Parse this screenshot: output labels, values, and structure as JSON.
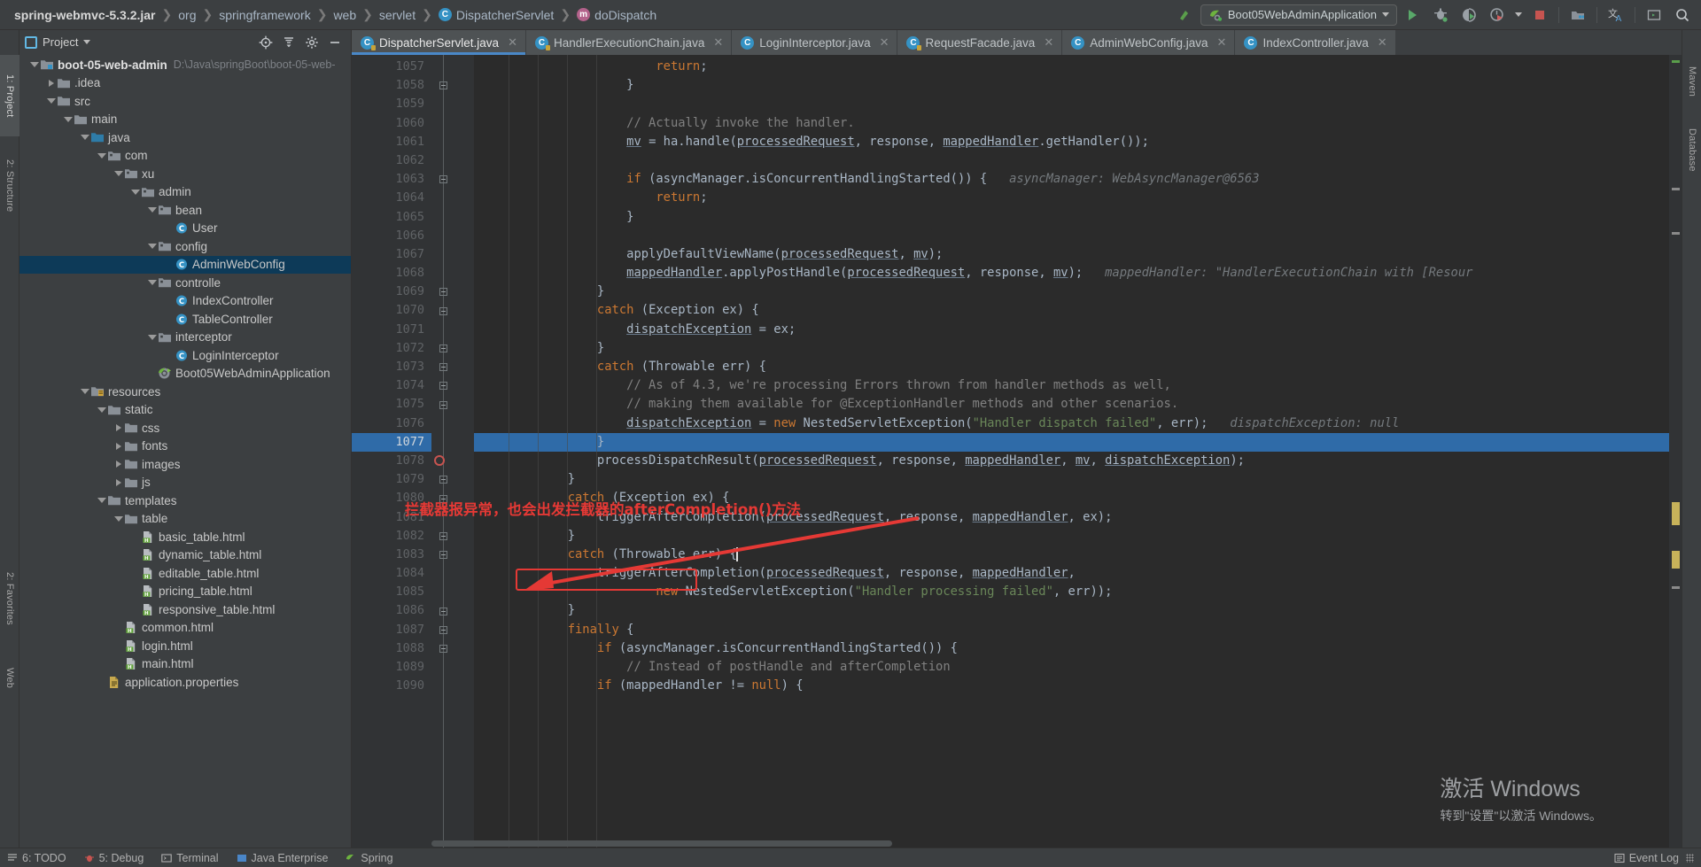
{
  "breadcrumb": {
    "items": [
      {
        "label": "spring-webmvc-5.3.2.jar",
        "icon": "jar-icon"
      },
      {
        "label": "org",
        "icon": "package-icon"
      },
      {
        "label": "springframework",
        "icon": "package-icon"
      },
      {
        "label": "web",
        "icon": "package-icon"
      },
      {
        "label": "servlet",
        "icon": "package-icon"
      },
      {
        "label": "DispatcherServlet",
        "icon": "class-icon"
      },
      {
        "label": "doDispatch",
        "icon": "method-icon"
      }
    ]
  },
  "toolbar": {
    "run_config": "Boot05WebAdminApplication",
    "buttons": [
      {
        "name": "run-button",
        "label": "Run"
      },
      {
        "name": "debug-button",
        "label": "Debug"
      },
      {
        "name": "run-with-coverage-button",
        "label": "Run with Coverage"
      },
      {
        "name": "profiler-button",
        "label": "Profiler"
      },
      {
        "name": "stop-button",
        "label": "Stop"
      },
      {
        "name": "project-structure-button",
        "label": "Project Structure"
      },
      {
        "name": "translate-button",
        "label": "Translate"
      },
      {
        "name": "terminal-button",
        "label": "Terminal"
      },
      {
        "name": "search-everywhere-button",
        "label": "Search Everywhere"
      }
    ]
  },
  "project_panel": {
    "title": "Project",
    "actions": [
      "locate-icon",
      "collapse-all-icon",
      "settings-icon",
      "hide-icon"
    ],
    "tree": [
      {
        "depth": 0,
        "twisty": "down",
        "icon": "module-folder",
        "label": "boot-05-web-admin",
        "bold": true,
        "path": "D:\\Java\\springBoot\\boot-05-web-",
        "selected": false
      },
      {
        "depth": 1,
        "twisty": "right",
        "icon": "folder",
        "label": ".idea",
        "selected": false
      },
      {
        "depth": 1,
        "twisty": "down",
        "icon": "folder",
        "label": "src",
        "selected": false
      },
      {
        "depth": 2,
        "twisty": "down",
        "icon": "folder",
        "label": "main",
        "selected": false
      },
      {
        "depth": 3,
        "twisty": "down",
        "icon": "source-folder",
        "label": "java",
        "selected": false
      },
      {
        "depth": 4,
        "twisty": "down",
        "icon": "package",
        "label": "com",
        "selected": false
      },
      {
        "depth": 5,
        "twisty": "down",
        "icon": "package",
        "label": "xu",
        "selected": false
      },
      {
        "depth": 6,
        "twisty": "down",
        "icon": "package",
        "label": "admin",
        "selected": false
      },
      {
        "depth": 7,
        "twisty": "down",
        "icon": "package",
        "label": "bean",
        "selected": false
      },
      {
        "depth": 8,
        "twisty": "none",
        "icon": "class",
        "label": "User",
        "selected": false
      },
      {
        "depth": 7,
        "twisty": "down",
        "icon": "package",
        "label": "config",
        "selected": false
      },
      {
        "depth": 8,
        "twisty": "none",
        "icon": "class",
        "label": "AdminWebConfig",
        "selected": true
      },
      {
        "depth": 7,
        "twisty": "down",
        "icon": "package",
        "label": "controlle",
        "selected": false
      },
      {
        "depth": 8,
        "twisty": "none",
        "icon": "class",
        "label": "IndexController",
        "selected": false
      },
      {
        "depth": 8,
        "twisty": "none",
        "icon": "class",
        "label": "TableController",
        "selected": false
      },
      {
        "depth": 7,
        "twisty": "down",
        "icon": "package",
        "label": "interceptor",
        "selected": false
      },
      {
        "depth": 8,
        "twisty": "none",
        "icon": "class",
        "label": "LoginInterceptor",
        "selected": false
      },
      {
        "depth": 7,
        "twisty": "none",
        "icon": "spring-class",
        "label": "Boot05WebAdminApplication",
        "selected": false
      },
      {
        "depth": 3,
        "twisty": "down",
        "icon": "resource-folder",
        "label": "resources",
        "selected": false
      },
      {
        "depth": 4,
        "twisty": "down",
        "icon": "folder",
        "label": "static",
        "selected": false
      },
      {
        "depth": 5,
        "twisty": "right",
        "icon": "folder",
        "label": "css",
        "selected": false
      },
      {
        "depth": 5,
        "twisty": "right",
        "icon": "folder",
        "label": "fonts",
        "selected": false
      },
      {
        "depth": 5,
        "twisty": "right",
        "icon": "folder",
        "label": "images",
        "selected": false
      },
      {
        "depth": 5,
        "twisty": "right",
        "icon": "folder",
        "label": "js",
        "selected": false
      },
      {
        "depth": 4,
        "twisty": "down",
        "icon": "folder",
        "label": "templates",
        "selected": false
      },
      {
        "depth": 5,
        "twisty": "down",
        "icon": "folder",
        "label": "table",
        "selected": false
      },
      {
        "depth": 6,
        "twisty": "none",
        "icon": "html",
        "label": "basic_table.html",
        "selected": false
      },
      {
        "depth": 6,
        "twisty": "none",
        "icon": "html",
        "label": "dynamic_table.html",
        "selected": false
      },
      {
        "depth": 6,
        "twisty": "none",
        "icon": "html",
        "label": "editable_table.html",
        "selected": false
      },
      {
        "depth": 6,
        "twisty": "none",
        "icon": "html",
        "label": "pricing_table.html",
        "selected": false
      },
      {
        "depth": 6,
        "twisty": "none",
        "icon": "html",
        "label": "responsive_table.html",
        "selected": false
      },
      {
        "depth": 5,
        "twisty": "none",
        "icon": "html",
        "label": "common.html",
        "selected": false
      },
      {
        "depth": 5,
        "twisty": "none",
        "icon": "html",
        "label": "login.html",
        "selected": false
      },
      {
        "depth": 5,
        "twisty": "none",
        "icon": "html",
        "label": "main.html",
        "selected": false
      },
      {
        "depth": 4,
        "twisty": "none",
        "icon": "properties",
        "label": "application.properties",
        "selected": false
      }
    ]
  },
  "editor_tabs": [
    {
      "label": "DispatcherServlet.java",
      "icon": "class-icon",
      "active": true,
      "readonly": true
    },
    {
      "label": "HandlerExecutionChain.java",
      "icon": "class-icon",
      "active": false,
      "readonly": true
    },
    {
      "label": "LoginInterceptor.java",
      "icon": "class-icon",
      "active": false,
      "readonly": false
    },
    {
      "label": "RequestFacade.java",
      "icon": "class-icon",
      "active": false,
      "readonly": true
    },
    {
      "label": "AdminWebConfig.java",
      "icon": "class-icon",
      "active": false,
      "readonly": false
    },
    {
      "label": "IndexController.java",
      "icon": "class-icon",
      "active": false,
      "readonly": false
    }
  ],
  "editor": {
    "first_line": 1057,
    "highlighted_line": 1077,
    "breakpoint_line": 1078,
    "caret_line": 1083,
    "lines": [
      {
        "n": 1057,
        "indent": 6,
        "tokens": [
          {
            "t": "return",
            "c": "kw"
          },
          {
            "t": ";",
            "c": "plain"
          }
        ]
      },
      {
        "n": 1058,
        "indent": 5,
        "tokens": [
          {
            "t": "}",
            "c": "plain"
          }
        ],
        "fold": "minus"
      },
      {
        "n": 1059,
        "indent": 0,
        "tokens": []
      },
      {
        "n": 1060,
        "indent": 5,
        "tokens": [
          {
            "t": "// Actually invoke the handler.",
            "c": "cmt"
          }
        ]
      },
      {
        "n": 1061,
        "indent": 5,
        "tokens": [
          {
            "t": "mv",
            "c": "und"
          },
          {
            "t": " = ha.handle(",
            "c": "plain"
          },
          {
            "t": "processedRequest",
            "c": "und"
          },
          {
            "t": ", response, ",
            "c": "plain"
          },
          {
            "t": "mappedHandler",
            "c": "und"
          },
          {
            "t": ".getHandler());",
            "c": "plain"
          }
        ]
      },
      {
        "n": 1062,
        "indent": 0,
        "tokens": []
      },
      {
        "n": 1063,
        "indent": 5,
        "tokens": [
          {
            "t": "if",
            "c": "kw"
          },
          {
            "t": " (asyncManager.isConcurrentHandlingStarted()) {",
            "c": "plain"
          },
          {
            "t": "   asyncManager: WebAsyncManager@6563",
            "c": "hint"
          }
        ],
        "fold": "plus"
      },
      {
        "n": 1064,
        "indent": 6,
        "tokens": [
          {
            "t": "return",
            "c": "kw"
          },
          {
            "t": ";",
            "c": "plain"
          }
        ]
      },
      {
        "n": 1065,
        "indent": 5,
        "tokens": [
          {
            "t": "}",
            "c": "plain"
          }
        ]
      },
      {
        "n": 1066,
        "indent": 0,
        "tokens": []
      },
      {
        "n": 1067,
        "indent": 5,
        "tokens": [
          {
            "t": "applyDefaultViewName(",
            "c": "plain"
          },
          {
            "t": "processedRequest",
            "c": "und"
          },
          {
            "t": ", ",
            "c": "plain"
          },
          {
            "t": "mv",
            "c": "und"
          },
          {
            "t": ");",
            "c": "plain"
          }
        ]
      },
      {
        "n": 1068,
        "indent": 5,
        "tokens": [
          {
            "t": "mappedHandler",
            "c": "und"
          },
          {
            "t": ".applyPostHandle(",
            "c": "plain"
          },
          {
            "t": "processedRequest",
            "c": "und"
          },
          {
            "t": ", response, ",
            "c": "plain"
          },
          {
            "t": "mv",
            "c": "und"
          },
          {
            "t": ");",
            "c": "plain"
          },
          {
            "t": "   mappedHandler: \"HandlerExecutionChain with [Resour",
            "c": "hint"
          }
        ]
      },
      {
        "n": 1069,
        "indent": 4,
        "tokens": [
          {
            "t": "}",
            "c": "plain"
          }
        ],
        "fold": "minus"
      },
      {
        "n": 1070,
        "indent": 4,
        "tokens": [
          {
            "t": "catch",
            "c": "kw"
          },
          {
            "t": " (Exception ex) {",
            "c": "plain"
          }
        ],
        "fold": "minus"
      },
      {
        "n": 1071,
        "indent": 5,
        "tokens": [
          {
            "t": "dispatchException",
            "c": "und"
          },
          {
            "t": " = ex;",
            "c": "plain"
          }
        ]
      },
      {
        "n": 1072,
        "indent": 4,
        "tokens": [
          {
            "t": "}",
            "c": "plain"
          }
        ],
        "fold": "minus"
      },
      {
        "n": 1073,
        "indent": 4,
        "tokens": [
          {
            "t": "catch",
            "c": "kw"
          },
          {
            "t": " (Throwable err) {",
            "c": "plain"
          }
        ],
        "fold": "plus"
      },
      {
        "n": 1074,
        "indent": 5,
        "tokens": [
          {
            "t": "// As of 4.3, we're processing Errors thrown from handler methods as well,",
            "c": "cmt"
          }
        ],
        "fold": "plus"
      },
      {
        "n": 1075,
        "indent": 5,
        "tokens": [
          {
            "t": "// making them available for @ExceptionHandler methods and other scenarios.",
            "c": "cmt"
          }
        ],
        "fold": "minus"
      },
      {
        "n": 1076,
        "indent": 5,
        "tokens": [
          {
            "t": "dispatchException",
            "c": "und"
          },
          {
            "t": " = ",
            "c": "plain"
          },
          {
            "t": "new",
            "c": "kw"
          },
          {
            "t": " NestedServletException(",
            "c": "plain"
          },
          {
            "t": "\"Handler dispatch failed\"",
            "c": "str"
          },
          {
            "t": ", err);",
            "c": "plain"
          },
          {
            "t": "   dispatchException: null",
            "c": "hint"
          }
        ]
      },
      {
        "n": 1077,
        "indent": 4,
        "tokens": [
          {
            "t": "}",
            "c": "plain"
          }
        ],
        "highlight": true
      },
      {
        "n": 1078,
        "indent": 4,
        "tokens": [
          {
            "t": "processDispatchResult(",
            "c": "plain"
          },
          {
            "t": "processedRequest",
            "c": "und"
          },
          {
            "t": ", response, ",
            "c": "plain"
          },
          {
            "t": "mappedHandler",
            "c": "und"
          },
          {
            "t": ", ",
            "c": "plain"
          },
          {
            "t": "mv",
            "c": "und"
          },
          {
            "t": ", ",
            "c": "plain"
          },
          {
            "t": "dispatchException",
            "c": "und"
          },
          {
            "t": ");",
            "c": "plain"
          }
        ],
        "breakpoint": true
      },
      {
        "n": 1079,
        "indent": 3,
        "tokens": [
          {
            "t": "}",
            "c": "plain"
          }
        ],
        "fold": "minus"
      },
      {
        "n": 1080,
        "indent": 3,
        "tokens": [
          {
            "t": "catch",
            "c": "kw"
          },
          {
            "t": " (Exception ex) {",
            "c": "plain"
          }
        ],
        "fold": "minus"
      },
      {
        "n": 1081,
        "indent": 4,
        "tokens": [
          {
            "t": "triggerAfterCompletion(",
            "c": "plain"
          },
          {
            "t": "processedRequest",
            "c": "und"
          },
          {
            "t": ", response, ",
            "c": "plain"
          },
          {
            "t": "mappedHandler",
            "c": "und"
          },
          {
            "t": ", ex);",
            "c": "plain"
          }
        ]
      },
      {
        "n": 1082,
        "indent": 3,
        "tokens": [
          {
            "t": "}",
            "c": "plain"
          }
        ],
        "fold": "minus"
      },
      {
        "n": 1083,
        "indent": 3,
        "tokens": [
          {
            "t": "catch",
            "c": "kw"
          },
          {
            "t": " (Throwable err) {",
            "c": "plain"
          }
        ],
        "fold": "minus",
        "caret": true
      },
      {
        "n": 1084,
        "indent": 4,
        "tokens": [
          {
            "t": "triggerAfterCompletion(",
            "c": "plain"
          },
          {
            "t": "processedRequest",
            "c": "und"
          },
          {
            "t": ", response, ",
            "c": "plain"
          },
          {
            "t": "mappedHandler",
            "c": "und"
          },
          {
            "t": ",",
            "c": "plain"
          }
        ]
      },
      {
        "n": 1085,
        "indent": 6,
        "tokens": [
          {
            "t": "new",
            "c": "kw"
          },
          {
            "t": " NestedServletException(",
            "c": "plain"
          },
          {
            "t": "\"Handler processing failed\"",
            "c": "str"
          },
          {
            "t": ", err));",
            "c": "plain"
          }
        ]
      },
      {
        "n": 1086,
        "indent": 3,
        "tokens": [
          {
            "t": "}",
            "c": "plain"
          }
        ],
        "fold": "minus"
      },
      {
        "n": 1087,
        "indent": 3,
        "tokens": [
          {
            "t": "finally",
            "c": "kw"
          },
          {
            "t": " {",
            "c": "plain"
          }
        ],
        "fold": "minus"
      },
      {
        "n": 1088,
        "indent": 4,
        "tokens": [
          {
            "t": "if",
            "c": "kw"
          },
          {
            "t": " (asyncManager.isConcurrentHandlingStarted()) {",
            "c": "plain"
          }
        ],
        "fold": "minus"
      },
      {
        "n": 1089,
        "indent": 5,
        "tokens": [
          {
            "t": "// Instead of postHandle and afterCompletion",
            "c": "cmt"
          }
        ]
      },
      {
        "n": 1090,
        "indent": 4,
        "tokens": [
          {
            "t": "if",
            "c": "kw"
          },
          {
            "t": " (mappedHandler != ",
            "c": "plain"
          },
          {
            "t": "null",
            "c": "kw"
          },
          {
            "t": ") {",
            "c": "plain"
          }
        ]
      }
    ]
  },
  "annotation": {
    "text": "拦截器报异常，也会出发拦截器的afterCompletion()方法",
    "color": "#e53935",
    "highlight_box_target": "triggerAfterCompletion"
  },
  "watermark": {
    "line1": "激活 Windows",
    "line2": "转到\"设置\"以激活 Windows。"
  },
  "left_rail": [
    {
      "label": "1: Project",
      "selected": true
    },
    {
      "label": "2: Structure",
      "selected": false
    },
    {
      "label": "2: Favorites",
      "selected": false
    },
    {
      "label": "Web",
      "selected": false
    }
  ],
  "right_rail": [
    {
      "label": "Maven",
      "selected": false
    },
    {
      "label": "Database",
      "selected": false
    }
  ],
  "status_bar": {
    "left_items": [
      {
        "label": "6: TODO",
        "icon": "todo-icon"
      },
      {
        "label": "5: Debug",
        "icon": "debug-icon"
      },
      {
        "label": "Terminal",
        "icon": "terminal-icon"
      },
      {
        "label": "Java Enterprise",
        "icon": "java-icon"
      },
      {
        "label": "Spring",
        "icon": "spring-icon"
      }
    ],
    "right_items": [
      {
        "label": "Event Log",
        "icon": "event-log-icon"
      }
    ]
  }
}
